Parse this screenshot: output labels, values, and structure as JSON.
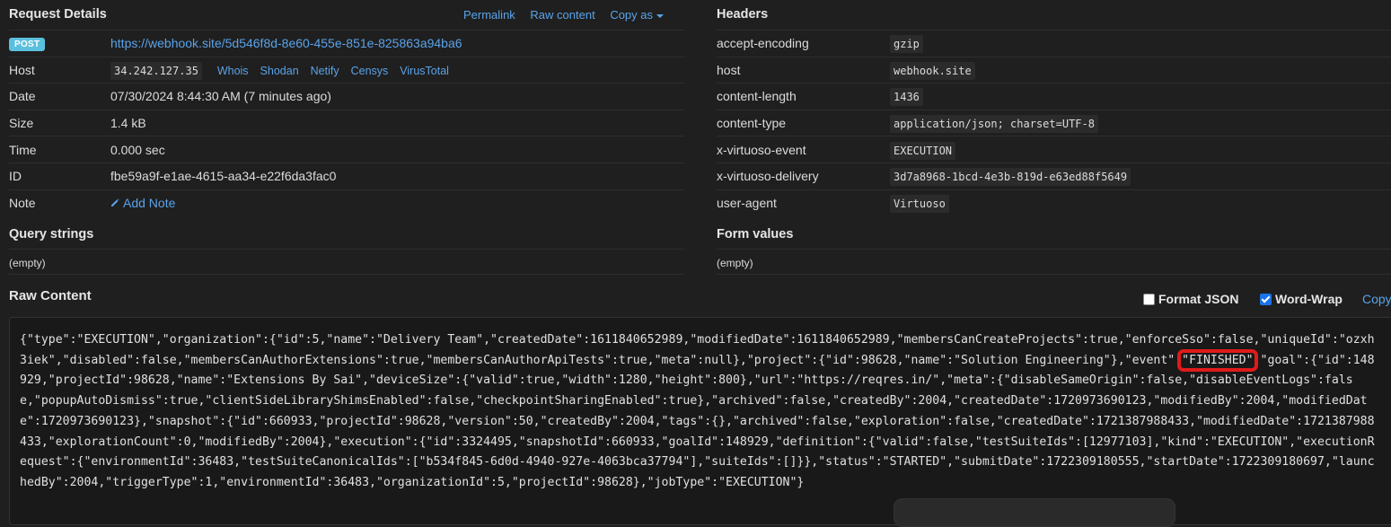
{
  "request_details": {
    "title": "Request Details",
    "links": [
      "Permalink",
      "Raw content",
      "Copy as"
    ],
    "method": "POST",
    "url": "https://webhook.site/5d546f8d-8e60-455e-851e-825863a94ba6",
    "rows": {
      "host": {
        "label": "Host",
        "value": "34.242.127.35",
        "links": [
          "Whois",
          "Shodan",
          "Netify",
          "Censys",
          "VirusTotal"
        ]
      },
      "date": {
        "label": "Date",
        "value": "07/30/2024 8:44:30 AM (7 minutes ago)"
      },
      "size": {
        "label": "Size",
        "value": "1.4 kB"
      },
      "time": {
        "label": "Time",
        "value": "0.000 sec"
      },
      "id": {
        "label": "ID",
        "value": "fbe59a9f-e1ae-4615-aa34-e22f6da3fac0"
      },
      "note": {
        "label": "Note",
        "value": "Add Note"
      }
    }
  },
  "headers": {
    "title": "Headers",
    "rows": [
      {
        "key": "accept-encoding",
        "value": "gzip"
      },
      {
        "key": "host",
        "value": "webhook.site"
      },
      {
        "key": "content-length",
        "value": "1436"
      },
      {
        "key": "content-type",
        "value": "application/json; charset=UTF-8"
      },
      {
        "key": "x-virtuoso-event",
        "value": "EXECUTION"
      },
      {
        "key": "x-virtuoso-delivery",
        "value": "3d7a8968-1bcd-4e3b-819d-e63ed88f5649"
      },
      {
        "key": "user-agent",
        "value": "Virtuoso"
      }
    ]
  },
  "query_strings": {
    "title": "Query strings",
    "value": "(empty)"
  },
  "form_values": {
    "title": "Form values",
    "value": "(empty)"
  },
  "raw_content": {
    "title": "Raw Content",
    "format_json": {
      "label": "Format JSON",
      "checked": false
    },
    "word_wrap": {
      "label": "Word-Wrap",
      "checked": true
    },
    "copy_label": "Copy",
    "text_before": "{\"type\":\"EXECUTION\",\"organization\":{\"id\":5,\"name\":\"Delivery Team\",\"createdDate\":1611840652989,\"modifiedDate\":1611840652989,\"membersCanCreateProjects\":true,\"enforceSso\":false,\"uniqueId\":\"ozxh3iek\",\"disabled\":false,\"membersCanAuthorExtensions\":true,\"membersCanAuthorApiTests\":true,\"meta\":null},\"project\":{\"id\":98628,\"name\":\"Solution Engineering\"},\"event\":",
    "text_highlight": "\"FINISHED\"",
    "text_after": ",\"goal\":{\"id\":148929,\"projectId\":98628,\"name\":\"Extensions By Sai\",\"deviceSize\":{\"valid\":true,\"width\":1280,\"height\":800},\"url\":\"https://reqres.in/\",\"meta\":{\"disableSameOrigin\":false,\"disableEventLogs\":false,\"popupAutoDismiss\":true,\"clientSideLibraryShimsEnabled\":false,\"checkpointSharingEnabled\":true},\"archived\":false,\"createdBy\":2004,\"createdDate\":1720973690123,\"modifiedBy\":2004,\"modifiedDate\":1720973690123},\"snapshot\":{\"id\":660933,\"projectId\":98628,\"version\":50,\"createdBy\":2004,\"tags\":{},\"archived\":false,\"exploration\":false,\"createdDate\":1721387988433,\"modifiedDate\":1721387988433,\"explorationCount\":0,\"modifiedBy\":2004},\"execution\":{\"id\":3324495,\"snapshotId\":660933,\"goalId\":148929,\"definition\":{\"valid\":false,\"testSuiteIds\":[12977103],\"kind\":\"EXECUTION\",\"executionRequest\":{\"environmentId\":36483,\"testSuiteCanonicalIds\":[\"b534f845-6d0d-4940-927e-4063bca37794\"],\"suiteIds\":[]}},\"status\":\"STARTED\",\"submitDate\":1722309180555,\"startDate\":1722309180697,\"launchedBy\":2004,\"triggerType\":1,\"environmentId\":36483,\"organizationId\":5,\"projectId\":98628},\"jobType\":\"EXECUTION\"}"
  }
}
